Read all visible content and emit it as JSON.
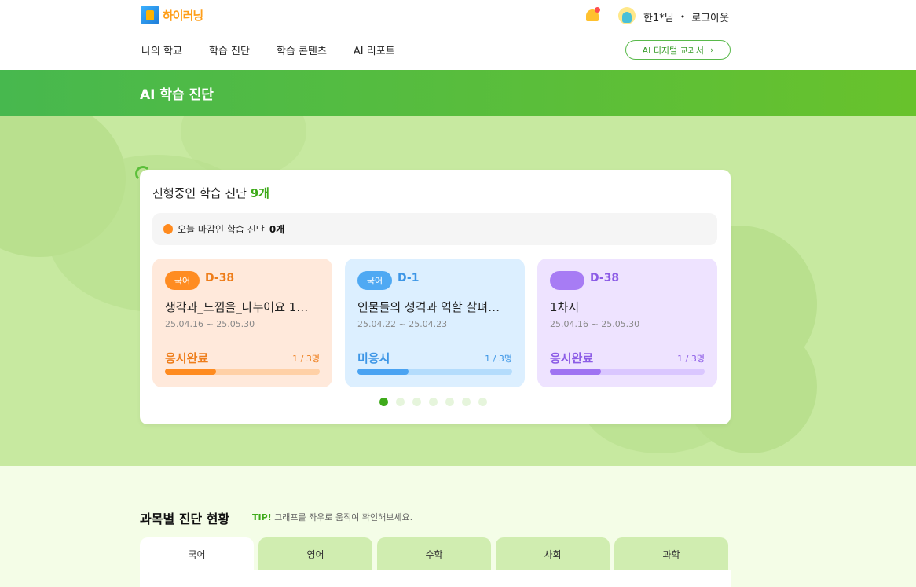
{
  "header": {
    "logo_text": "하이러닝",
    "user_label": "한1*님",
    "dot": "•",
    "logout": "로그아웃",
    "nav": [
      "나의 학교",
      "학습 진단",
      "학습 콘텐츠",
      "AI 리포트"
    ],
    "ai_textbook_button": "AI 디지털 교과서",
    "ai_textbook_arrow": "›"
  },
  "banner": {
    "title": "AI 학습 진단"
  },
  "ongoing": {
    "title": "진행중인 학습 진단",
    "count": "9개",
    "today_label": "오늘 마감인 학습 진단",
    "today_count": "0개",
    "cards": [
      {
        "subject": "국어",
        "dday": "D-38",
        "name": "생각과_느낌을_나누어요 1…",
        "period": "25.04.16 ~ 25.05.30",
        "status": "응시완료",
        "people": "1 / 3명",
        "progress": 0.33
      },
      {
        "subject": "국어",
        "dday": "D-1",
        "name": "인물들의 성격과 역할 살펴…",
        "period": "25.04.22 ~ 25.04.23",
        "status": "미응시",
        "people": "1 / 3명",
        "progress": 0.33
      },
      {
        "subject": "",
        "dday": "D-38",
        "name": "1차시",
        "period": "25.04.16 ~ 25.05.30",
        "status": "응시완료",
        "people": "1 / 3명",
        "progress": 0.33
      }
    ],
    "pagination": {
      "total": 7,
      "active": 1
    }
  },
  "subject_status": {
    "title": "과목별 진단 현황",
    "tip_label": "TIP!",
    "tip_text": "그래프를 좌우로 움직여 확인해보세요.",
    "tabs": [
      "국어",
      "영어",
      "수학",
      "사회",
      "과학"
    ],
    "active_tab": "국어"
  },
  "colors": {
    "brand_green": "#3eaa1a",
    "orange": "#ff8c21",
    "blue": "#4fa9f3",
    "purple": "#a77cf4"
  }
}
